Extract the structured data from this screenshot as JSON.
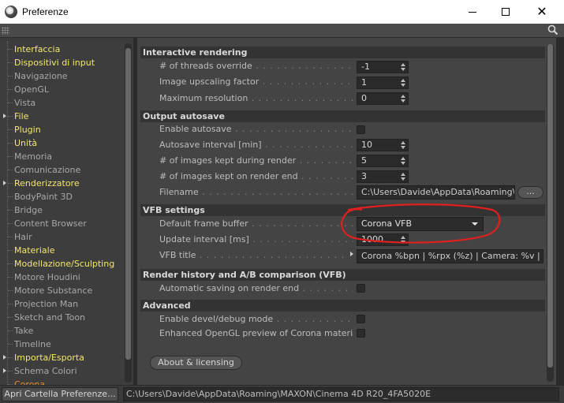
{
  "window": {
    "title": "Preferenze",
    "minimize_icon": "minimize-icon",
    "maximize_icon": "maximize-icon",
    "close_icon": "close-icon",
    "close_glyph": "✕"
  },
  "nav": {
    "items": [
      {
        "label": "Interfaccia",
        "color": "yellow",
        "expandable": false
      },
      {
        "label": "Dispositivi di input",
        "color": "yellow",
        "expandable": false
      },
      {
        "label": "Navigazione",
        "color": "gray",
        "expandable": false
      },
      {
        "label": "OpenGL",
        "color": "gray",
        "expandable": false
      },
      {
        "label": "Vista",
        "color": "gray",
        "expandable": false
      },
      {
        "label": "File",
        "color": "yellow",
        "expandable": true
      },
      {
        "label": "Plugin",
        "color": "yellow",
        "expandable": false
      },
      {
        "label": "Unità",
        "color": "yellow",
        "expandable": false
      },
      {
        "label": "Memoria",
        "color": "gray",
        "expandable": false
      },
      {
        "label": "Comunicazione",
        "color": "gray",
        "expandable": false
      },
      {
        "label": "Renderizzatore",
        "color": "yellow",
        "expandable": true
      },
      {
        "label": "BodyPaint 3D",
        "color": "gray",
        "expandable": false
      },
      {
        "label": "Bridge",
        "color": "gray",
        "expandable": false
      },
      {
        "label": "Content Browser",
        "color": "gray",
        "expandable": false
      },
      {
        "label": "Hair",
        "color": "gray",
        "expandable": false
      },
      {
        "label": "Materiale",
        "color": "yellow",
        "expandable": false
      },
      {
        "label": "Modellazione/Sculpting",
        "color": "yellow",
        "expandable": false
      },
      {
        "label": "Motore Houdini",
        "color": "gray",
        "expandable": false
      },
      {
        "label": "Motore Substance",
        "color": "gray",
        "expandable": false
      },
      {
        "label": "Projection Man",
        "color": "gray",
        "expandable": false
      },
      {
        "label": "Sketch and Toon",
        "color": "gray",
        "expandable": false
      },
      {
        "label": "Take",
        "color": "gray",
        "expandable": false
      },
      {
        "label": "Timeline",
        "color": "gray",
        "expandable": false
      },
      {
        "label": "Importa/Esporta",
        "color": "yellow",
        "expandable": true
      },
      {
        "label": "Schema Colori",
        "color": "gray",
        "expandable": true
      },
      {
        "label": "Corona",
        "color": "orange",
        "expandable": false
      }
    ]
  },
  "sections": {
    "interactive_rendering": {
      "title": "Interactive rendering",
      "threads_label": "# of threads override",
      "threads_value": "-1",
      "upscaling_label": "Image upscaling factor",
      "upscaling_value": "1",
      "maxres_label": "Maximum resolution",
      "maxres_value": "0"
    },
    "output_autosave": {
      "title": "Output autosave",
      "enable_label": "Enable autosave",
      "interval_label": "Autosave interval [min]",
      "interval_value": "10",
      "kept_during_label": "# of images kept during render",
      "kept_during_value": "5",
      "kept_end_label": "# of images kept on render end",
      "kept_end_value": "3",
      "filename_label": "Filename",
      "filename_value": "C:\\Users\\Davide\\AppData\\Roaming\\M",
      "browse_label": "..."
    },
    "vfb_settings": {
      "title": "VFB settings",
      "dfb_label": "Default frame buffer",
      "dfb_value": "Corona VFB",
      "update_label": "Update interval [ms]",
      "update_value": "1000",
      "vfb_title_label": "VFB title",
      "vfb_title_value": "Corona %bpn | %rpx (%z) | Camera: %v | Fram"
    },
    "render_history": {
      "title": "Render history and A/B comparison (VFB)",
      "autosave_label": "Automatic saving on render end"
    },
    "advanced": {
      "title": "Advanced",
      "devel_label": "Enable devel/debug mode",
      "opengl_label": "Enhanced OpenGL preview of Corona materials"
    }
  },
  "about_button": "About & licensing",
  "bottom": {
    "open_folder_label": "Apri Cartella Preferenze...",
    "path": "C:\\Users\\Davide\\AppData\\Roaming\\MAXON\\Cinema 4D R20_4FA5020E"
  },
  "colors": {
    "nav_yellow": "#f3e86a",
    "nav_gray": "#a8a8a8",
    "nav_orange": "#e98a2a",
    "annotation_red": "#e0201f"
  }
}
